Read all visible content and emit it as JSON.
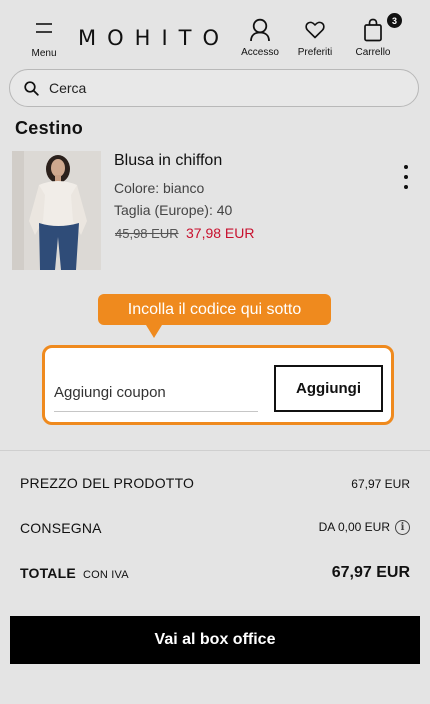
{
  "header": {
    "menu_label": "Menu",
    "logo": "MOHITO",
    "login_label": "Accesso",
    "favorites_label": "Preferiti",
    "cart_label": "Carrello",
    "cart_count": "3"
  },
  "search": {
    "placeholder": "Cerca"
  },
  "page_title": "Cestino",
  "product": {
    "name": "Blusa in chiffon",
    "color": "Colore: bianco",
    "size": "Taglia (Europe): 40",
    "old_price": "45,98 EUR",
    "new_price": "37,98 EUR",
    "price_color": "#c8102e"
  },
  "coupon": {
    "hint": "Incolla il codice qui sotto",
    "placeholder": "Aggiungi coupon",
    "button": "Aggiungi",
    "accent_color": "#ef8a1e"
  },
  "summary": {
    "product_price_label": "PREZZO DEL PRODOTTO",
    "product_price_value": "67,97 EUR",
    "delivery_label": "CONSEGNA",
    "delivery_value": "DA 0,00 EUR",
    "total_label": "TOTALE",
    "total_vat": "CON IVA",
    "total_value": "67,97 EUR"
  },
  "checkout_button": "Vai al box office",
  "icons": [
    "hamburger-icon",
    "user-icon",
    "heart-icon",
    "bag-icon",
    "search-icon",
    "more-vertical-icon",
    "info-icon"
  ]
}
